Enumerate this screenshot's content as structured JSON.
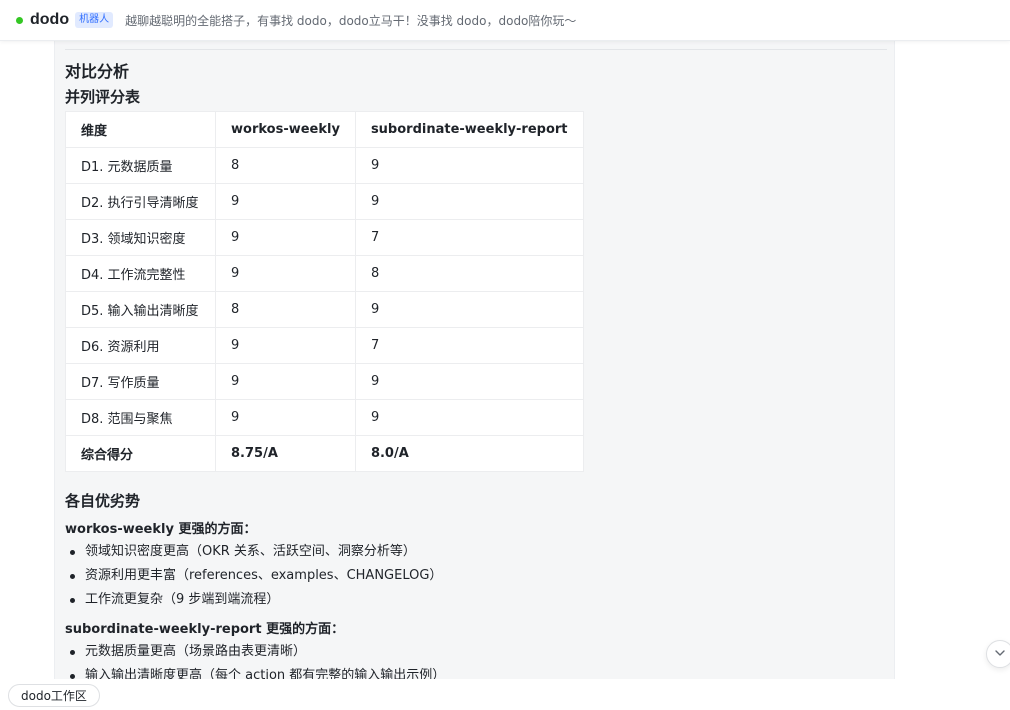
{
  "header": {
    "bot_name": "dodo",
    "badge": "机器人",
    "description": "越聊越聪明的全能搭子，有事找 dodo，dodo立马干！没事找 dodo，dodo陪你玩～",
    "status_color": "#34c724"
  },
  "section": {
    "title": "对比分析",
    "table_title": "并列评分表",
    "table": {
      "headers": [
        "维度",
        "workos-weekly",
        "subordinate-weekly-report"
      ],
      "rows": [
        [
          "D1. 元数据质量",
          "8",
          "9"
        ],
        [
          "D2. 执行引导清晰度",
          "9",
          "9"
        ],
        [
          "D3. 领域知识密度",
          "9",
          "7"
        ],
        [
          "D4. 工作流完整性",
          "9",
          "8"
        ],
        [
          "D5. 输入输出清晰度",
          "8",
          "9"
        ],
        [
          "D6. 资源利用",
          "9",
          "7"
        ],
        [
          "D7. 写作质量",
          "9",
          "9"
        ],
        [
          "D8. 范围与聚焦",
          "9",
          "9"
        ]
      ],
      "total": [
        "综合得分",
        "8.75/A",
        "8.0/A"
      ]
    },
    "pros_title": "各自优劣势",
    "group1": {
      "title": "workos-weekly 更强的方面：",
      "items": [
        "领域知识密度更高（OKR 关系、活跃空间、洞察分析等）",
        "资源利用更丰富（references、examples、CHANGELOG）",
        "工作流更复杂（9 步端到端流程）"
      ]
    },
    "group2": {
      "title": "subordinate-weekly-report 更强的方面：",
      "items": [
        "元数据质量更高（场景路由表更清晰）",
        "输入输出清晰度更高（每个 action 都有完整的输入输出示例）"
      ]
    }
  },
  "scroll_button": {
    "icon": "chevron-down-icon"
  },
  "bottom": {
    "workspace_label": "dodo工作区"
  }
}
